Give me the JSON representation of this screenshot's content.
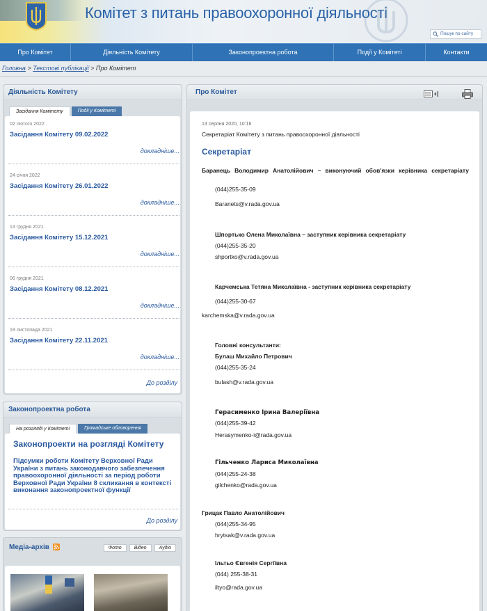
{
  "header": {
    "title": "Комітет з питань правоохоронної діяльності",
    "search_label": "Пошук по сайту"
  },
  "nav": [
    "Про Комітет",
    "Діяльність Комітету",
    "Законопроектна робота",
    "Події у Комітеті",
    "Контакти"
  ],
  "breadcrumb": {
    "home": "Головна",
    "sep1": " > ",
    "texts": "Текстові публікації",
    "sep2": " > ",
    "current": "Про Комітет"
  },
  "left": {
    "activity": {
      "title": "Діяльність Комітету",
      "tabs": [
        "Засідання Комітету",
        "Події у Комітеті"
      ],
      "events": [
        {
          "date": "02 лютого 2022",
          "title": "Засідання Комітету 09.02.2022",
          "more": "докладніше..."
        },
        {
          "date": "24 січня 2022",
          "title": "Засідання Комітету 26.01.2022",
          "more": "докладніше..."
        },
        {
          "date": "13 грудня 2021",
          "title": "Засідання Комітету 15.12.2021",
          "more": "докладніше..."
        },
        {
          "date": "06 грудня 2021",
          "title": "Засідання Комітету 08.12.2021",
          "more": "докладніше..."
        },
        {
          "date": "19 листопада 2021",
          "title": "Засідання Комітету 22.11.2021",
          "more": "докладніше..."
        }
      ],
      "to_section": "До розділу"
    },
    "legislation": {
      "title": "Законопроектна робота",
      "tabs": [
        "На розгляді у Комітеті",
        "Громадське обговорення"
      ],
      "heading": "Законопроекти на розгляді Комітету",
      "item": "Підсумки роботи Комітету Верховної Ради України з питань законодавчого забезпечення правоохоронної діяльності за період роботи Верховної Ради України 8 скликання в контексті виконання законопроектної функції",
      "to_section": "До розділу"
    },
    "media": {
      "title": "Медіа-архів",
      "buttons": [
        "Фото",
        "Відео",
        "Аудіо"
      ]
    }
  },
  "main": {
    "title": "Про Комітет",
    "date": "13 серпня 2020, 10:16",
    "source": "Секретаріат Комітету з питань правоохоронної діяльності",
    "heading": "Секретаріат",
    "staff": [
      {
        "name": "Баранець Володимир Анатолійович – виконуючий обов'язки керівника секретаріату",
        "phone": "(044)255-35-09",
        "email": "Baranets@v.rada.gov.ua"
      },
      {
        "name": "Шпортько Олена Миколаївна – заступник керівника секретаріату",
        "phone": "(044)255-35-20",
        "email": "shportko@v.rada.gov.ua"
      },
      {
        "name": "Карчемська Тетяна Миколаївна -  заступник керівника секретаріату",
        "phone": "(044)255-30-67",
        "email": "karchemska@v.rada.gov.ua"
      },
      {
        "pre": "Головні консультанти:",
        "name": "Булаш Михайло Петрович",
        "phone": "(044)255-35-24",
        "email": "bulash@v.rada.gov.ua"
      },
      {
        "name": "Герасименко Ірина Валеріївна",
        "phone": "(044)255-39-42",
        "email": "Herasymenko-i@rada.gov.ua"
      },
      {
        "name": "Гільченко Лариса Миколаївна",
        "phone": "(044)255-24-38",
        "email": "gilchenko@rada.gov.ua"
      },
      {
        "name": "Грицак Павло Анатолійович",
        "phone": "(044)255-34-95",
        "email": "hrytsak@v.rada.gov.ua"
      },
      {
        "name": "Ільтьо Євгенія Сергіївна",
        "phone": "(044) 255-38-31",
        "email": "iltyo@rada.gov.ua"
      }
    ]
  },
  "colors": {
    "nav": "#2f72b5",
    "link": "#2a5aa0",
    "title": "#2a62a8"
  }
}
